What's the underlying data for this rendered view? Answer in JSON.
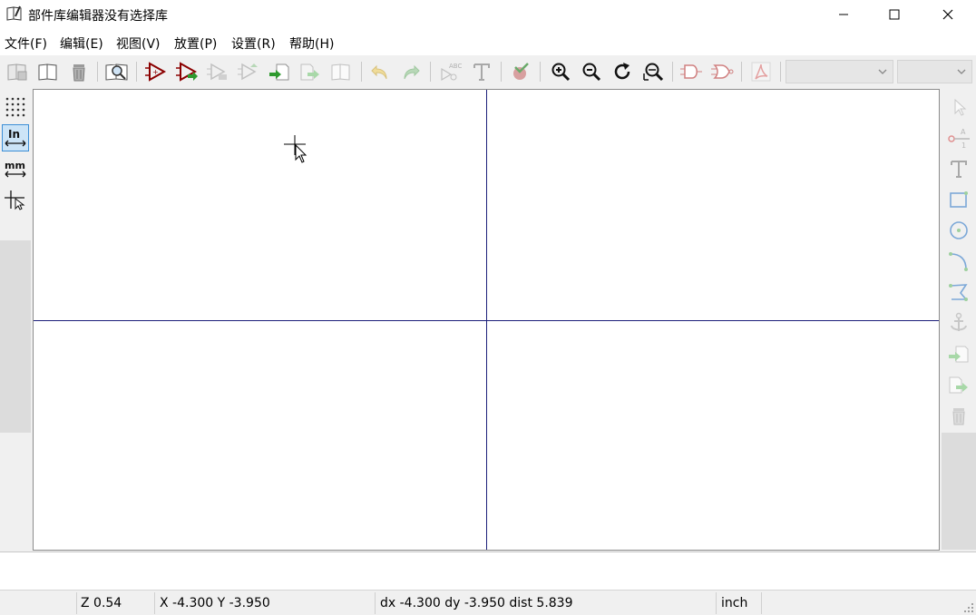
{
  "window": {
    "title": "部件库编辑器没有选择库",
    "icon": "library-book-icon",
    "controls": [
      "minimize-icon",
      "maximize-icon",
      "close-icon"
    ]
  },
  "menu": {
    "items": [
      {
        "label": "文件(F)"
      },
      {
        "label": "编辑(E)"
      },
      {
        "label": "视图(V)"
      },
      {
        "label": "放置(P)"
      },
      {
        "label": "设置(R)"
      },
      {
        "label": "帮助(H)"
      }
    ]
  },
  "toolbar": {
    "icons": [
      "save-library-icon",
      "open-library-icon",
      "delete-library-icon",
      "library-browser-icon",
      "new-part-icon",
      "import-part-icon",
      "export-part-icon",
      "copy-part-icon",
      "import-component-icon",
      "export-component-icon",
      "save-part-icon",
      "undo-icon",
      "redo-icon",
      "check-pins-icon",
      "text-icon",
      "erc-check-icon",
      "zoom-in-icon",
      "zoom-out-icon",
      "zoom-redraw-icon",
      "zoom-fit-icon",
      "body-style-normal-icon",
      "body-style-demorgan-icon",
      "datasheet-pdf-icon"
    ],
    "combo1_value": "",
    "combo2_value": ""
  },
  "left_toolbar": {
    "icons": [
      "grid-icon",
      "units-inch-icon",
      "units-mm-icon",
      "fullscreen-cursor-icon"
    ],
    "inch_label": "In",
    "mm_label": "mm"
  },
  "right_toolbar": {
    "icons": [
      "select-arrow-icon",
      "pin-icon",
      "text-icon",
      "rectangle-icon",
      "circle-icon",
      "arc-icon",
      "polyline-icon",
      "anchor-icon",
      "import-shape-icon",
      "export-shape-icon",
      "delete-icon"
    ]
  },
  "status": {
    "zoom": "Z 0.54",
    "position": "X -4.300  Y -3.950",
    "delta": "dx -4.300  dy -3.950  dist 5.839",
    "units": "inch"
  },
  "colors": {
    "axis": "#1c1f7a",
    "part_icon": "#8b0000",
    "accent_green": "#2e9a2e",
    "disabled_icon": "#b8b8b8"
  }
}
